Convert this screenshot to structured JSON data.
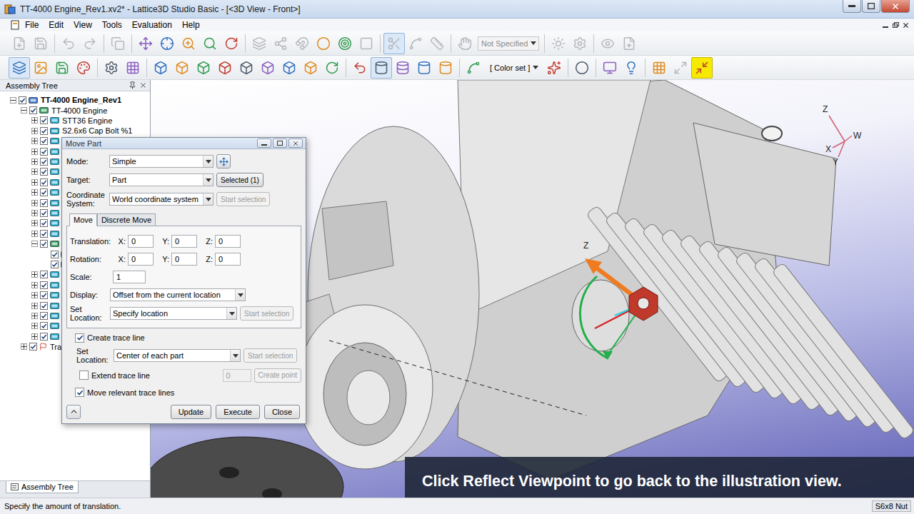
{
  "window": {
    "title": "TT-4000 Engine_Rev1.xv2* - Lattice3D Studio Basic - [<3D View - Front>]"
  },
  "menu": [
    "File",
    "Edit",
    "View",
    "Tools",
    "Evaluation",
    "Help"
  ],
  "toolbar1": [
    {
      "kind": "button",
      "disabled": true,
      "selected": false,
      "highlighted": false
    },
    {
      "kind": "button",
      "disabled": true,
      "selected": false,
      "highlighted": false
    },
    {
      "kind": "separator"
    },
    {
      "kind": "button",
      "disabled": true,
      "selected": false,
      "highlighted": false
    },
    {
      "kind": "button",
      "disabled": true,
      "selected": false,
      "highlighted": false
    },
    {
      "kind": "separator"
    },
    {
      "kind": "button",
      "disabled": true,
      "selected": false,
      "highlighted": false
    },
    {
      "kind": "separator"
    },
    {
      "kind": "button",
      "disabled": false,
      "selected": false,
      "highlighted": false
    },
    {
      "kind": "button",
      "disabled": false,
      "selected": false,
      "highlighted": false
    },
    {
      "kind": "button",
      "disabled": false,
      "selected": false,
      "highlighted": false
    },
    {
      "kind": "button",
      "disabled": false,
      "selected": false,
      "highlighted": false
    },
    {
      "kind": "button",
      "disabled": false,
      "selected": false,
      "highlighted": false
    },
    {
      "kind": "separator"
    },
    {
      "kind": "button",
      "disabled": true,
      "selected": false,
      "highlighted": false
    },
    {
      "kind": "button",
      "disabled": true,
      "selected": false,
      "highlighted": false
    },
    {
      "kind": "button",
      "disabled": true,
      "selected": false,
      "highlighted": false
    },
    {
      "kind": "button",
      "disabled": false,
      "selected": false,
      "highlighted": false
    },
    {
      "kind": "button",
      "disabled": false,
      "selected": false,
      "highlighted": false
    },
    {
      "kind": "button",
      "disabled": true,
      "selected": false,
      "highlighted": false
    },
    {
      "kind": "separator"
    },
    {
      "kind": "button",
      "disabled": true,
      "selected": true,
      "highlighted": false
    },
    {
      "kind": "button",
      "disabled": true,
      "selected": false,
      "highlighted": false
    },
    {
      "kind": "button",
      "disabled": true,
      "selected": false,
      "highlighted": false
    },
    {
      "kind": "separator"
    },
    {
      "kind": "button",
      "disabled": true,
      "selected": false,
      "highlighted": false
    },
    {
      "kind": "dropdown",
      "value": "Not Specified",
      "disabled": true
    },
    {
      "kind": "separator"
    },
    {
      "kind": "button",
      "disabled": true,
      "selected": false,
      "highlighted": false
    },
    {
      "kind": "button",
      "disabled": true,
      "selected": false,
      "highlighted": false
    },
    {
      "kind": "separator"
    },
    {
      "kind": "button",
      "disabled": true,
      "selected": false,
      "highlighted": false
    },
    {
      "kind": "button",
      "disabled": true,
      "selected": false,
      "highlighted": false
    }
  ],
  "toolbar2": [
    {
      "kind": "button",
      "disabled": false,
      "selected": true,
      "highlighted": false
    },
    {
      "kind": "button",
      "disabled": false,
      "selected": false,
      "highlighted": false
    },
    {
      "kind": "button",
      "disabled": false,
      "selected": false,
      "highlighted": false
    },
    {
      "kind": "button",
      "disabled": false,
      "selected": false,
      "highlighted": false
    },
    {
      "kind": "separator"
    },
    {
      "kind": "button",
      "disabled": false,
      "selected": false,
      "highlighted": false
    },
    {
      "kind": "button",
      "disabled": false,
      "selected": false,
      "highlighted": false
    },
    {
      "kind": "separator"
    },
    {
      "kind": "button",
      "disabled": false,
      "selected": false,
      "highlighted": false
    },
    {
      "kind": "button",
      "disabled": false,
      "selected": false,
      "highlighted": false
    },
    {
      "kind": "button",
      "disabled": false,
      "selected": false,
      "highlighted": false
    },
    {
      "kind": "button",
      "disabled": false,
      "selected": false,
      "highlighted": false
    },
    {
      "kind": "button",
      "disabled": false,
      "selected": false,
      "highlighted": false
    },
    {
      "kind": "button",
      "disabled": false,
      "selected": false,
      "highlighted": false
    },
    {
      "kind": "button",
      "disabled": false,
      "selected": false,
      "highlighted": false
    },
    {
      "kind": "button",
      "disabled": false,
      "selected": false,
      "highlighted": false
    },
    {
      "kind": "button",
      "disabled": false,
      "selected": false,
      "highlighted": false
    },
    {
      "kind": "separator"
    },
    {
      "kind": "button",
      "disabled": false,
      "selected": false,
      "highlighted": false
    },
    {
      "kind": "button",
      "disabled": false,
      "selected": true,
      "highlighted": false
    },
    {
      "kind": "button",
      "disabled": false,
      "selected": false,
      "highlighted": false
    },
    {
      "kind": "button",
      "disabled": false,
      "selected": false,
      "highlighted": false
    },
    {
      "kind": "button",
      "disabled": false,
      "selected": false,
      "highlighted": false
    },
    {
      "kind": "separator"
    },
    {
      "kind": "button",
      "disabled": false,
      "selected": false,
      "highlighted": false
    },
    {
      "kind": "dropdown",
      "value": "[ Color set ]",
      "disabled": false
    },
    {
      "kind": "button",
      "disabled": false,
      "selected": false,
      "highlighted": false
    },
    {
      "kind": "separator"
    },
    {
      "kind": "button",
      "disabled": false,
      "selected": false,
      "highlighted": false
    },
    {
      "kind": "separator"
    },
    {
      "kind": "button",
      "disabled": false,
      "selected": false,
      "highlighted": false
    },
    {
      "kind": "button",
      "disabled": false,
      "selected": false,
      "highlighted": false
    },
    {
      "kind": "separator"
    },
    {
      "kind": "button",
      "disabled": false,
      "selected": false,
      "highlighted": false
    },
    {
      "kind": "button",
      "disabled": true,
      "selected": false,
      "highlighted": false
    },
    {
      "kind": "button",
      "disabled": false,
      "selected": false,
      "highlighted": true
    }
  ],
  "tree_panel": {
    "title": "Assembly Tree",
    "tab": "Assembly Tree",
    "items": [
      {
        "label": "TT-4000 Engine_Rev1",
        "level": 0,
        "kind": "root",
        "expanded": true,
        "checked": true
      },
      {
        "label": "TT-4000 Engine",
        "level": 1,
        "kind": "assembly",
        "expanded": true,
        "checked": true
      },
      {
        "label": "STT36 Engine",
        "level": 2,
        "kind": "part",
        "expanded": false,
        "checked": true
      },
      {
        "label": "S2.6x6 Cap Bolt %1",
        "level": 2,
        "kind": "part",
        "expanded": false,
        "checked": true
      },
      {
        "label": "",
        "level": 2,
        "kind": "part",
        "expanded": false,
        "checked": true
      },
      {
        "label": "",
        "level": 2,
        "kind": "part",
        "expanded": false,
        "checked": true
      },
      {
        "label": "",
        "level": 2,
        "kind": "part",
        "expanded": false,
        "checked": true
      },
      {
        "label": "",
        "level": 2,
        "kind": "part",
        "expanded": false,
        "checked": true
      },
      {
        "label": "",
        "level": 2,
        "kind": "part",
        "expanded": false,
        "checked": true
      },
      {
        "label": "",
        "level": 2,
        "kind": "part",
        "expanded": false,
        "checked": true
      },
      {
        "label": "",
        "level": 2,
        "kind": "part",
        "expanded": false,
        "checked": true
      },
      {
        "label": "",
        "level": 2,
        "kind": "part",
        "expanded": false,
        "checked": true
      },
      {
        "label": "",
        "level": 2,
        "kind": "part",
        "expanded": false,
        "checked": true
      },
      {
        "label": "",
        "level": 2,
        "kind": "part",
        "expanded": false,
        "checked": true
      },
      {
        "label": "",
        "level": 2,
        "kind": "assembly",
        "expanded": true,
        "checked": true
      },
      {
        "label": "",
        "level": 3,
        "kind": "part",
        "expanded": false,
        "checked": true
      },
      {
        "label": "",
        "level": 3,
        "kind": "part",
        "expanded": false,
        "checked": true
      },
      {
        "label": "",
        "level": 2,
        "kind": "part",
        "expanded": false,
        "checked": true
      },
      {
        "label": "",
        "level": 2,
        "kind": "part",
        "expanded": false,
        "checked": true
      },
      {
        "label": "",
        "level": 2,
        "kind": "part",
        "expanded": false,
        "checked": true
      },
      {
        "label": "",
        "level": 2,
        "kind": "part",
        "expanded": false,
        "checked": true
      },
      {
        "label": "",
        "level": 2,
        "kind": "part",
        "expanded": false,
        "checked": true
      },
      {
        "label": "",
        "level": 2,
        "kind": "part",
        "expanded": false,
        "checked": true
      },
      {
        "label": "",
        "level": 2,
        "kind": "part",
        "expanded": false,
        "checked": true
      },
      {
        "label": "Tra",
        "level": 1,
        "kind": "trace",
        "expanded": false,
        "checked": true
      }
    ]
  },
  "view": {
    "axes": [
      "Z",
      "W",
      "X",
      "Y"
    ],
    "gizmo_label": "Z",
    "caption": "Click Reflect Viewpoint to go back to the illustration view."
  },
  "dialog": {
    "title": "Move Part",
    "mode": {
      "label": "Mode:",
      "value": "Simple"
    },
    "target": {
      "label": "Target:",
      "value": "Part",
      "button": "Selected (1)",
      "button_disabled": false
    },
    "coordinate_system": {
      "label": "Coordinate System:",
      "value": "World coordinate system",
      "button": "Start selection",
      "button_disabled": true
    },
    "tabs": [
      {
        "label": "Move",
        "selected": true
      },
      {
        "label": "Discrete Move",
        "selected": false
      }
    ],
    "vectors": [
      {
        "label": "Translation:",
        "values": [
          {
            "axis": "X:",
            "value": "0"
          },
          {
            "axis": "Y:",
            "value": "0"
          },
          {
            "axis": "Z:",
            "value": "0"
          }
        ]
      },
      {
        "label": "Rotation:",
        "values": [
          {
            "axis": "X:",
            "value": "0"
          },
          {
            "axis": "Y:",
            "value": "0"
          },
          {
            "axis": "Z:",
            "value": "0"
          }
        ]
      }
    ],
    "scale": {
      "label": "Scale:",
      "value": "1"
    },
    "display": {
      "label": "Display:",
      "value": "Offset from the current location"
    },
    "set_location": {
      "label": "Set Location:",
      "value": "Specify location",
      "button": "Start selection",
      "button_disabled": true
    },
    "create_trace_line": {
      "label": "Create trace line",
      "checked": true
    },
    "trace_location": {
      "label": "Set Location:",
      "value": "Center of each part",
      "button": "Start selection",
      "button_disabled": true
    },
    "extend_trace_line": {
      "label": "Extend trace line",
      "checked": false,
      "value": "0",
      "value_disabled": true,
      "button": "Create point",
      "button_disabled": true
    },
    "move_relevant": {
      "label": "Move relevant trace lines",
      "checked": true
    },
    "buttons": [
      "Update",
      "Execute",
      "Close"
    ]
  },
  "status_bar": {
    "message": "Specify the amount of translation.",
    "selection": "S6x8 Nut"
  }
}
